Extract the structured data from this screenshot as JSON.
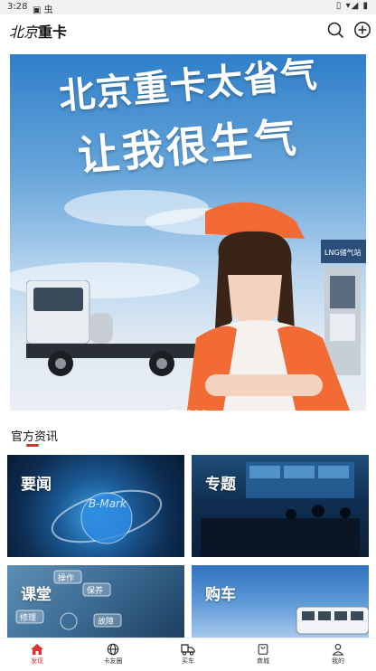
{
  "status_bar": {
    "time": "3:28",
    "left_icons": "▣ 虫",
    "right_icons": "▯ ▾◢ ▮"
  },
  "header": {
    "logo_script": "北京",
    "logo_text": "重卡",
    "icons": [
      "search-icon",
      "add-circle-icon"
    ]
  },
  "banner": {
    "headline_1": "北京重卡太省气",
    "headline_2": "让我很生气",
    "station_sign": "LNG储气站",
    "active_slide": 0,
    "slide_count": 5
  },
  "section": {
    "title": "官方资讯",
    "accent_color": "#d33333"
  },
  "cards": [
    {
      "label": "要闻",
      "watermark": "B-Mark"
    },
    {
      "label": "专题"
    },
    {
      "label": "课堂",
      "tags": [
        "操作",
        "保养",
        "修理",
        "故障"
      ]
    },
    {
      "label": "购车"
    }
  ],
  "tabbar": {
    "items": [
      {
        "label": "发现",
        "icon": "home-icon",
        "active": true
      },
      {
        "label": "卡友圈",
        "icon": "globe-icon",
        "active": false
      },
      {
        "label": "买车",
        "icon": "truck-icon",
        "active": false
      },
      {
        "label": "商城",
        "icon": "shopping-bag-icon",
        "active": false
      },
      {
        "label": "我的",
        "icon": "user-icon",
        "active": false
      }
    ],
    "active_color": "#d33333"
  }
}
